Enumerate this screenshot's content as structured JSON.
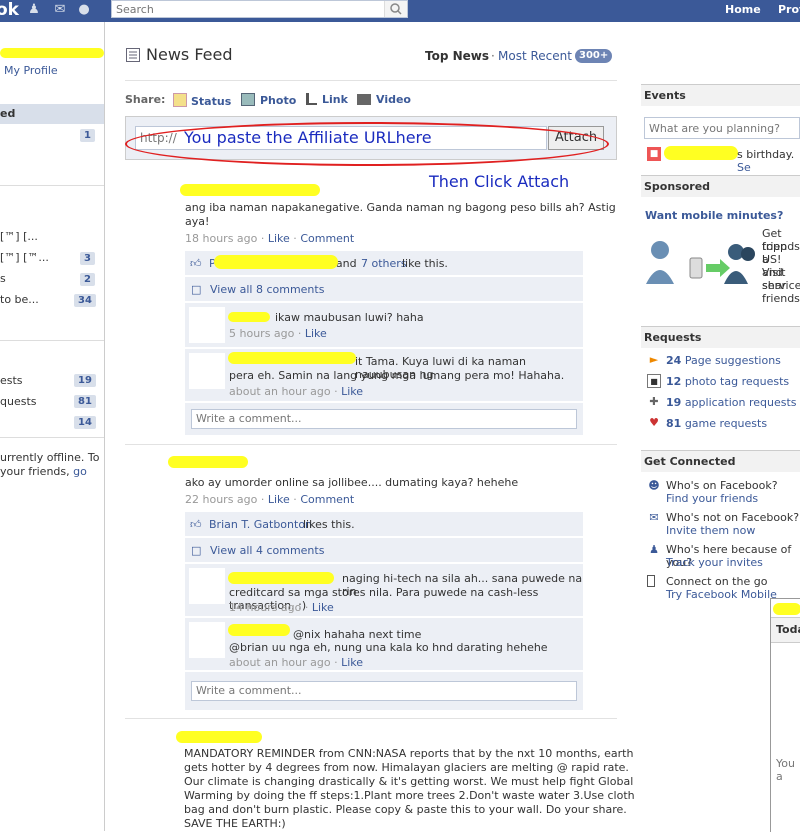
{
  "topbar": {
    "logo": "ok",
    "search_placeholder": "Search",
    "home": "Home",
    "profile": "Profile"
  },
  "left": {
    "my_profile": "My Profile",
    "selected_item": "ed",
    "counts": [
      "1",
      "3",
      "2",
      "34",
      "19",
      "81",
      "14"
    ],
    "items": [
      "[™] [...",
      "[™] [™...",
      "s",
      " to be...",
      "ests",
      "quests"
    ],
    "offline_line1": "urrently offline. To",
    "offline_line2": "your friends,",
    "offline_go": "go"
  },
  "main": {
    "title": "News Feed",
    "top_news": "Top News",
    "sep": "·",
    "most_recent": "Most Recent",
    "recent_count": "300+",
    "share_label": "Share:",
    "share_status": "Status",
    "share_photo": "Photo",
    "share_link": "Link",
    "share_video": "Video",
    "url_prefix": "http://",
    "url_annotation": "You paste the Affiliate URLhere",
    "attach": "Attach",
    "then_click": "Then Click Attach"
  },
  "stories": [
    {
      "text_line1": "ang iba naman napakanegative. Ganda naman ng bagong peso bills ah? Astig",
      "text_line2": "aya!",
      "time": "18 hours ago",
      "like": "Like",
      "comment": "Comment",
      "likes_prefix": "P",
      "likes_mid": "it and",
      "likes_others": "7 others",
      "likes_suffix": "like this.",
      "view_all": "View all 8 comments",
      "c1_text": "ikaw maubusan luwi? haha",
      "c1_time": "5 hours ago",
      "c2_line1": "it Tama. Kuya luwi di ka naman nauubusan ng",
      "c2_line2": "pera eh. Samin na lang yung mga lumang pera mo! Hahaha.",
      "c2_time": "about an hour ago",
      "write": "Write a comment..."
    },
    {
      "text_line1": "ako ay umorder online sa jollibee.... dumating kaya? hehehe",
      "time": "22 hours ago",
      "like": "Like",
      "comment": "Comment",
      "likes_name": "Brian T. Gatbonton",
      "likes_suffix": "likes this.",
      "view_all": "View all 4 comments",
      "c1_line1": "naging hi-tech na sila ah... sana puwede na rin",
      "c1_line2": "creditcard sa mga stores nila. Para puwede na cash-less transaction. :)",
      "c1_time": "14 hours ago",
      "c2_line1": "@nix hahaha next time",
      "c2_line2": "@brian uu nga eh, nung una kala ko hnd darating hehehe",
      "c2_time": "about an hour ago",
      "write": "Write a comment..."
    },
    {
      "lines": [
        "MANDATORY REMINDER from CNN:NASA reports that by the nxt 10 months, earth",
        "gets hotter by 4 degrees from now. Himalayan glaciers are melting @ rapid rate.",
        "Our climate is changing drastically & it's getting worst. We must help fight Global",
        "Warming by doing the ff steps:1.Plant more trees 2.Don't waste water 3.Use cloth",
        "bag and don't burn plastic. Please copy & paste this to your wall. Do your share.",
        "SAVE THE EARTH:)"
      ]
    }
  ],
  "right": {
    "events": "Events",
    "events_placeholder": "What are you planning?",
    "birthday": "s birthday.",
    "birthday_link": "Se",
    "sponsored": "Sponsored",
    "ad_title": "Want mobile minutes?",
    "ad_lines": [
      "Get topp",
      "friends a",
      "US! Visit",
      "and shar",
      "service",
      "friends."
    ],
    "requests": "Requests",
    "req": [
      {
        "count": "24",
        "label": "Page suggestions"
      },
      {
        "count": "12",
        "label": "photo tag requests"
      },
      {
        "count": "19",
        "label": "application requests"
      },
      {
        "count": "81",
        "label": "game requests"
      }
    ],
    "get_connected": "Get Connected",
    "gc": [
      {
        "q": "Who's on Facebook?",
        "a": "Find your friends"
      },
      {
        "q": "Who's not on Facebook?",
        "a": "Invite them now"
      },
      {
        "q": "Who's here because of you?",
        "a": "Track your invites"
      },
      {
        "q": "Connect on the go",
        "a": "Try Facebook Mobile"
      }
    ],
    "chat_today": "Toda",
    "chat_you": "You a"
  },
  "colors": {
    "brand": "#3b5998",
    "highlight": "#ffff22",
    "annotation_red": "#e02020",
    "annotation_blue": "#1a2bbf"
  }
}
